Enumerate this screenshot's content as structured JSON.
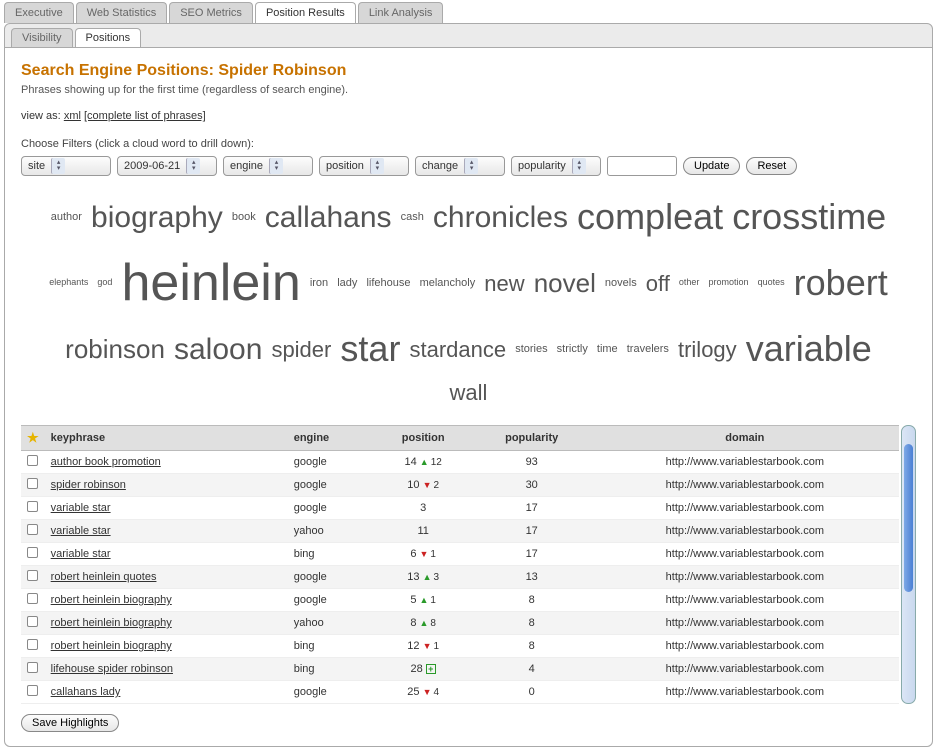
{
  "top_tabs": [
    "Executive",
    "Web Statistics",
    "SEO Metrics",
    "Position Results",
    "Link Analysis"
  ],
  "top_tab_active": 3,
  "sub_tabs": [
    "Visibility",
    "Positions"
  ],
  "sub_tab_active": 1,
  "title": "Search Engine Positions: Spider Robinson",
  "subtitle": "Phrases showing up for the first time (regardless of search engine).",
  "viewas": {
    "label": "view as:",
    "xml": "xml",
    "complete": "[complete list of phrases]"
  },
  "filters_label": "Choose Filters (click a cloud word to drill down):",
  "filters": {
    "site": "site",
    "date": "2009-06-21",
    "engine": "engine",
    "position": "position",
    "change": "change",
    "popularity": "popularity",
    "search": ""
  },
  "buttons": {
    "update": "Update",
    "reset": "Reset",
    "save": "Save Highlights"
  },
  "cloud": [
    {
      "w": "author",
      "s": "sz11"
    },
    {
      "w": "biography",
      "s": "sz30"
    },
    {
      "w": "book",
      "s": "sz11"
    },
    {
      "w": "callahans",
      "s": "sz30"
    },
    {
      "w": "cash",
      "s": "sz11"
    },
    {
      "w": "chronicles",
      "s": "sz30"
    },
    {
      "w": "compleat",
      "s": "sz36"
    },
    {
      "w": "crosstime",
      "s": "sz36"
    },
    {
      "w": "elephants",
      "s": "sz9"
    },
    {
      "w": "god",
      "s": "sz9"
    },
    {
      "w": "heinlein",
      "s": "sz52"
    },
    {
      "w": "iron",
      "s": "sz11"
    },
    {
      "w": "lady",
      "s": "sz11"
    },
    {
      "w": "lifehouse",
      "s": "sz11"
    },
    {
      "w": "melancholy",
      "s": "sz11"
    },
    {
      "w": "new",
      "s": "sz22"
    },
    {
      "w": "novel",
      "s": "sz26"
    },
    {
      "w": "novels",
      "s": "sz11"
    },
    {
      "w": "off",
      "s": "sz22"
    },
    {
      "w": "other",
      "s": "sz9"
    },
    {
      "w": "promotion",
      "s": "sz9"
    },
    {
      "w": "quotes",
      "s": "sz9"
    },
    {
      "w": "robert",
      "s": "sz36"
    },
    {
      "w": "robinson",
      "s": "sz26"
    },
    {
      "w": "saloon",
      "s": "sz30"
    },
    {
      "w": "spider",
      "s": "sz22"
    },
    {
      "w": "star",
      "s": "sz36"
    },
    {
      "w": "stardance",
      "s": "sz22"
    },
    {
      "w": "stories",
      "s": "sz11"
    },
    {
      "w": "strictly",
      "s": "sz11"
    },
    {
      "w": "time",
      "s": "sz11"
    },
    {
      "w": "travelers",
      "s": "sz11"
    },
    {
      "w": "trilogy",
      "s": "sz22"
    },
    {
      "w": "variable",
      "s": "sz36"
    },
    {
      "w": "wall",
      "s": "sz22"
    }
  ],
  "headers": {
    "keyphrase": "keyphrase",
    "engine": "engine",
    "position": "position",
    "popularity": "popularity",
    "domain": "domain"
  },
  "rows": [
    {
      "kp": "author book promotion",
      "eng": "google",
      "pos": 14,
      "dir": "up",
      "delta": 12,
      "pop": 93,
      "dom": "http://www.variablestarbook.com"
    },
    {
      "kp": "spider robinson",
      "eng": "google",
      "pos": 10,
      "dir": "down",
      "delta": 2,
      "pop": 30,
      "dom": "http://www.variablestarbook.com"
    },
    {
      "kp": "variable star",
      "eng": "google",
      "pos": 3,
      "dir": "",
      "delta": "",
      "pop": 17,
      "dom": "http://www.variablestarbook.com"
    },
    {
      "kp": "variable star",
      "eng": "yahoo",
      "pos": 11,
      "dir": "",
      "delta": "",
      "pop": 17,
      "dom": "http://www.variablestarbook.com"
    },
    {
      "kp": "variable star",
      "eng": "bing",
      "pos": 6,
      "dir": "down",
      "delta": 1,
      "pop": 17,
      "dom": "http://www.variablestarbook.com"
    },
    {
      "kp": "robert heinlein quotes",
      "eng": "google",
      "pos": 13,
      "dir": "up",
      "delta": 3,
      "pop": 13,
      "dom": "http://www.variablestarbook.com"
    },
    {
      "kp": "robert heinlein biography",
      "eng": "google",
      "pos": 5,
      "dir": "up",
      "delta": 1,
      "pop": 8,
      "dom": "http://www.variablestarbook.com"
    },
    {
      "kp": "robert heinlein biography",
      "eng": "yahoo",
      "pos": 8,
      "dir": "up",
      "delta": 8,
      "pop": 8,
      "dom": "http://www.variablestarbook.com"
    },
    {
      "kp": "robert heinlein biography",
      "eng": "bing",
      "pos": 12,
      "dir": "down",
      "delta": 1,
      "pop": 8,
      "dom": "http://www.variablestarbook.com"
    },
    {
      "kp": "lifehouse spider robinson",
      "eng": "bing",
      "pos": 28,
      "dir": "plus",
      "delta": "",
      "pop": 4,
      "dom": "http://www.variablestarbook.com"
    },
    {
      "kp": "callahans lady",
      "eng": "google",
      "pos": 25,
      "dir": "down",
      "delta": 4,
      "pop": 0,
      "dom": "http://www.variablestarbook.com"
    }
  ]
}
